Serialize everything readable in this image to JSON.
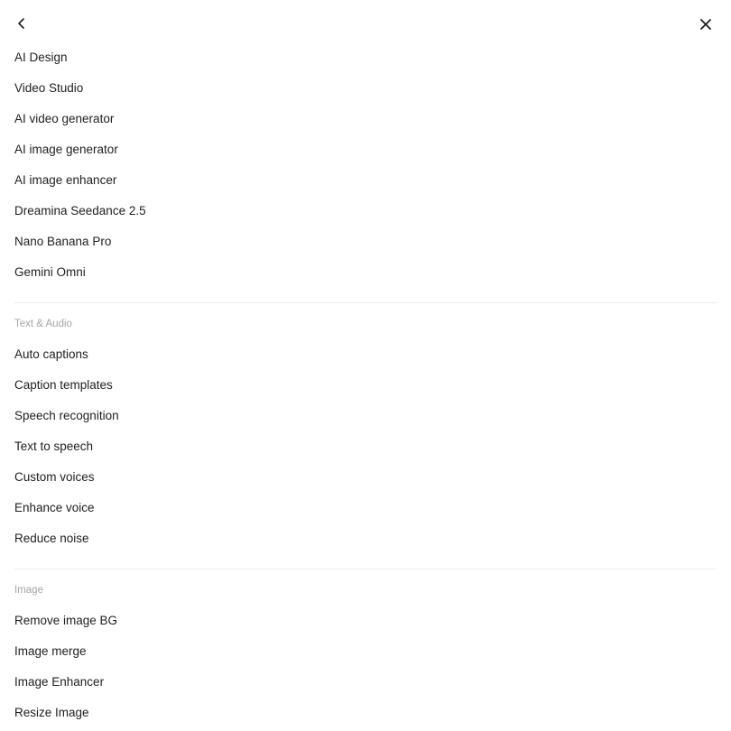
{
  "header": {
    "back_icon": "chevron-left-icon",
    "close_icon": "close-icon"
  },
  "sections": [
    {
      "label": "",
      "items": [
        {
          "label": "AI Design"
        },
        {
          "label": "Video Studio"
        },
        {
          "label": "AI video generator"
        },
        {
          "label": "AI image generator"
        },
        {
          "label": "AI image enhancer"
        },
        {
          "label": "Dreamina Seedance 2.5"
        },
        {
          "label": "Nano Banana Pro"
        },
        {
          "label": "Gemini Omni"
        }
      ]
    },
    {
      "label": "Text & Audio",
      "items": [
        {
          "label": "Auto captions"
        },
        {
          "label": "Caption templates"
        },
        {
          "label": "Speech recognition"
        },
        {
          "label": "Text to speech"
        },
        {
          "label": "Custom voices"
        },
        {
          "label": "Enhance voice"
        },
        {
          "label": "Reduce noise"
        }
      ]
    },
    {
      "label": "Image",
      "items": [
        {
          "label": "Remove image BG"
        },
        {
          "label": "Image merge"
        },
        {
          "label": "Image Enhancer"
        },
        {
          "label": "Resize Image"
        }
      ]
    }
  ],
  "colors": {
    "text": "#1f1f1f",
    "section_label": "#a6a6a6",
    "divider": "#ececec"
  }
}
